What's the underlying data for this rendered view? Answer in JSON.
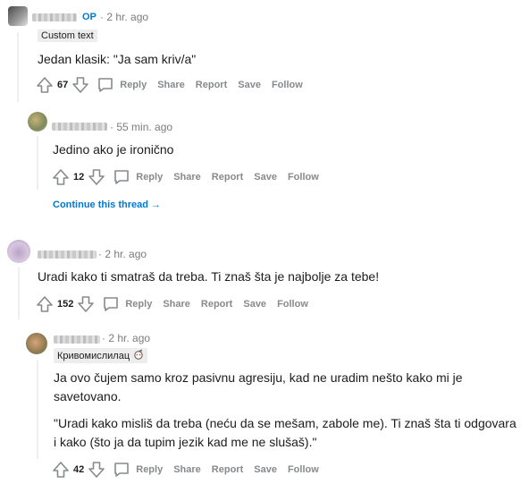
{
  "comments": [
    {
      "author_badge": "OP",
      "time": "2 hr. ago",
      "flair": "Custom text",
      "body": "Jedan klasik: \"Ja sam kriv/a\"",
      "votes": "67"
    },
    {
      "time": "55 min. ago",
      "body": "Jedino ako je ironično",
      "votes": "12",
      "continue_label": "Continue this thread"
    },
    {
      "time": "2 hr. ago",
      "body": "Uradi kako ti smatraš da treba. Ti znaš šta je najbolje za tebe!",
      "votes": "152"
    },
    {
      "time": "2 hr. ago",
      "flair": "Кривомислилац",
      "body_lines": [
        "Ja ovo čujem samo kroz pasivnu agresiju, kad ne uradim nešto kako mi je",
        "savetovano.",
        "\"Uradi kako misliš da treba (neću da se mešam, zabole me). Ti znaš šta ti odgovara",
        "i kako (što ja da tupim jezik kad me ne slušaš).\""
      ],
      "votes": "42"
    }
  ],
  "actions": {
    "reply": "Reply",
    "share": "Share",
    "report": "Report",
    "save": "Save",
    "follow": "Follow"
  },
  "icons": {
    "upvote": "upvote-arrow-icon",
    "downvote": "downvote-arrow-icon",
    "reply": "speech-bubble-icon",
    "continue": "arrow-right-icon",
    "flair_emoji": "snoo-face-icon"
  },
  "colors": {
    "op_badge": "#0079d3",
    "link": "#0079d3",
    "muted": "#878a8c",
    "thread_line": "#edeff1"
  }
}
